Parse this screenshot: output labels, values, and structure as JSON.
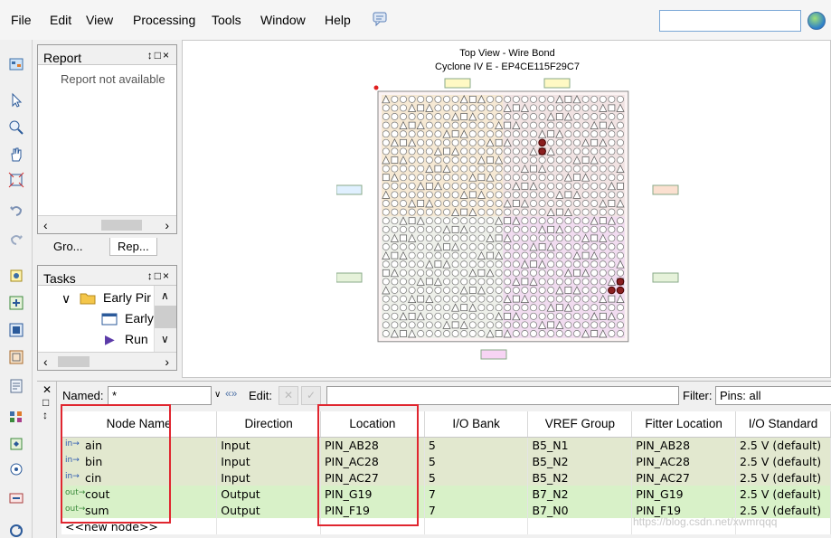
{
  "menu": {
    "items": [
      {
        "label": "File"
      },
      {
        "label": "Edit"
      },
      {
        "label": "View"
      },
      {
        "label": "Processing"
      },
      {
        "label": "Tools"
      },
      {
        "label": "Window"
      },
      {
        "label": "Help"
      }
    ]
  },
  "report_panel": {
    "title": "Report",
    "controls": "↕□×",
    "message": "Report not available"
  },
  "left_tabs": [
    {
      "label": "Gro..."
    },
    {
      "label": "Rep..."
    }
  ],
  "tasks_panel": {
    "title": "Tasks",
    "controls": "↕□×",
    "items": [
      {
        "label": "Early Pir"
      },
      {
        "label": "Early"
      },
      {
        "label": "Run"
      }
    ]
  },
  "chip": {
    "title": "Top View - Wire Bond",
    "device": "Cyclone IV E - EP4CE115F29C7"
  },
  "pin_planner": {
    "named_label": "Named:",
    "named_value": "*",
    "edit_label": "Edit:",
    "filter_label": "Filter:",
    "filter_value": "Pins: all",
    "columns": [
      "Node Name",
      "Direction",
      "Location",
      "I/O Bank",
      "VREF Group",
      "Fitter Location",
      "I/O Standard"
    ],
    "rows": [
      {
        "node": "ain",
        "direction": "Input",
        "location": "PIN_AB28",
        "bank": "5",
        "vref": "B5_N1",
        "fitter": "PIN_AB28",
        "standard": "2.5 V (default)"
      },
      {
        "node": "bin",
        "direction": "Input",
        "location": "PIN_AC28",
        "bank": "5",
        "vref": "B5_N2",
        "fitter": "PIN_AC28",
        "standard": "2.5 V (default)"
      },
      {
        "node": "cin",
        "direction": "Input",
        "location": "PIN_AC27",
        "bank": "5",
        "vref": "B5_N2",
        "fitter": "PIN_AC27",
        "standard": "2.5 V (default)"
      },
      {
        "node": "cout",
        "direction": "Output",
        "location": "PIN_G19",
        "bank": "7",
        "vref": "B7_N2",
        "fitter": "PIN_G19",
        "standard": "2.5 V (default)"
      },
      {
        "node": "sum",
        "direction": "Output",
        "location": "PIN_F19",
        "bank": "7",
        "vref": "B7_N0",
        "fitter": "PIN_F19",
        "standard": "2.5 V (default)"
      }
    ],
    "new_node": "<<new node>>"
  },
  "watermark": "https://blog.csdn.net/xwmrqqq",
  "colors": {
    "input_row": "#e2e8cf",
    "output_row": "#d8f1c8",
    "highlight": "#e0262f"
  }
}
